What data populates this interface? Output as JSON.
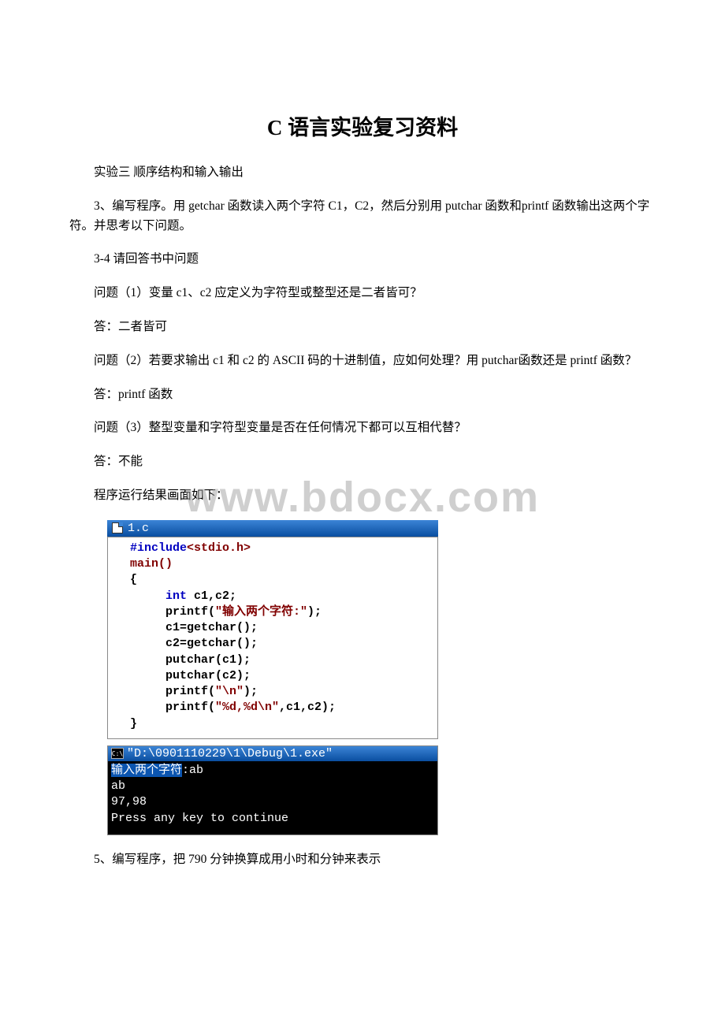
{
  "title": "C 语言实验复习资料",
  "paragraphs": {
    "p1": "实验三 顺序结构和输入输出",
    "p2": "3、编写程序。用 getchar 函数读入两个字符 C1，C2，然后分别用 putchar 函数和printf 函数输出这两个字符。并思考以下问题。",
    "p3": "3-4 请回答书中问题",
    "p4": "问题（1）变量 c1、c2 应定义为字符型或整型还是二者皆可？",
    "p5": "答：二者皆可",
    "p6": "问题（2）若要求输出 c1 和 c2 的 ASCII 码的十进制值，应如何处理？用 putchar函数还是 printf 函数？",
    "p7": "答：printf 函数",
    "p8": "问题（3）整型变量和字符型变量是否在任何情况下都可以互相代替？",
    "p9": "答：不能",
    "p10": "程序运行结果画面如下："
  },
  "watermark": "www.bdocx.com",
  "code_window": {
    "filename": "1.c",
    "lines": {
      "l1a": "#include",
      "l1b": "<stdio.h>",
      "l2": "main()",
      "l3": "{",
      "l4a": "     int",
      "l4b": " c1,c2;",
      "l5a": "     printf(",
      "l5b": "\"输入两个字符:\"",
      "l5c": ");",
      "l6": "     c1=getchar();",
      "l7": "     c2=getchar();",
      "l8": "     putchar(c1);",
      "l9": "     putchar(c2);",
      "l10a": "     printf(",
      "l10b": "\"\\n\"",
      "l10c": ");",
      "l11a": "     printf(",
      "l11b": "\"%d,%d\\n\"",
      "l11c": ",c1,c2);",
      "l12": "}"
    }
  },
  "console": {
    "cmd_icon": "C:\\",
    "title": "\"D:\\0901110229\\1\\Debug\\1.exe\"",
    "line1_hl": "输入两个字符",
    "line1_rest": ":ab",
    "line2": "ab",
    "line3": "97,98",
    "line4": "Press any key to continue"
  },
  "q5": "5、编写程序，把 790 分钟换算成用小时和分钟来表示"
}
